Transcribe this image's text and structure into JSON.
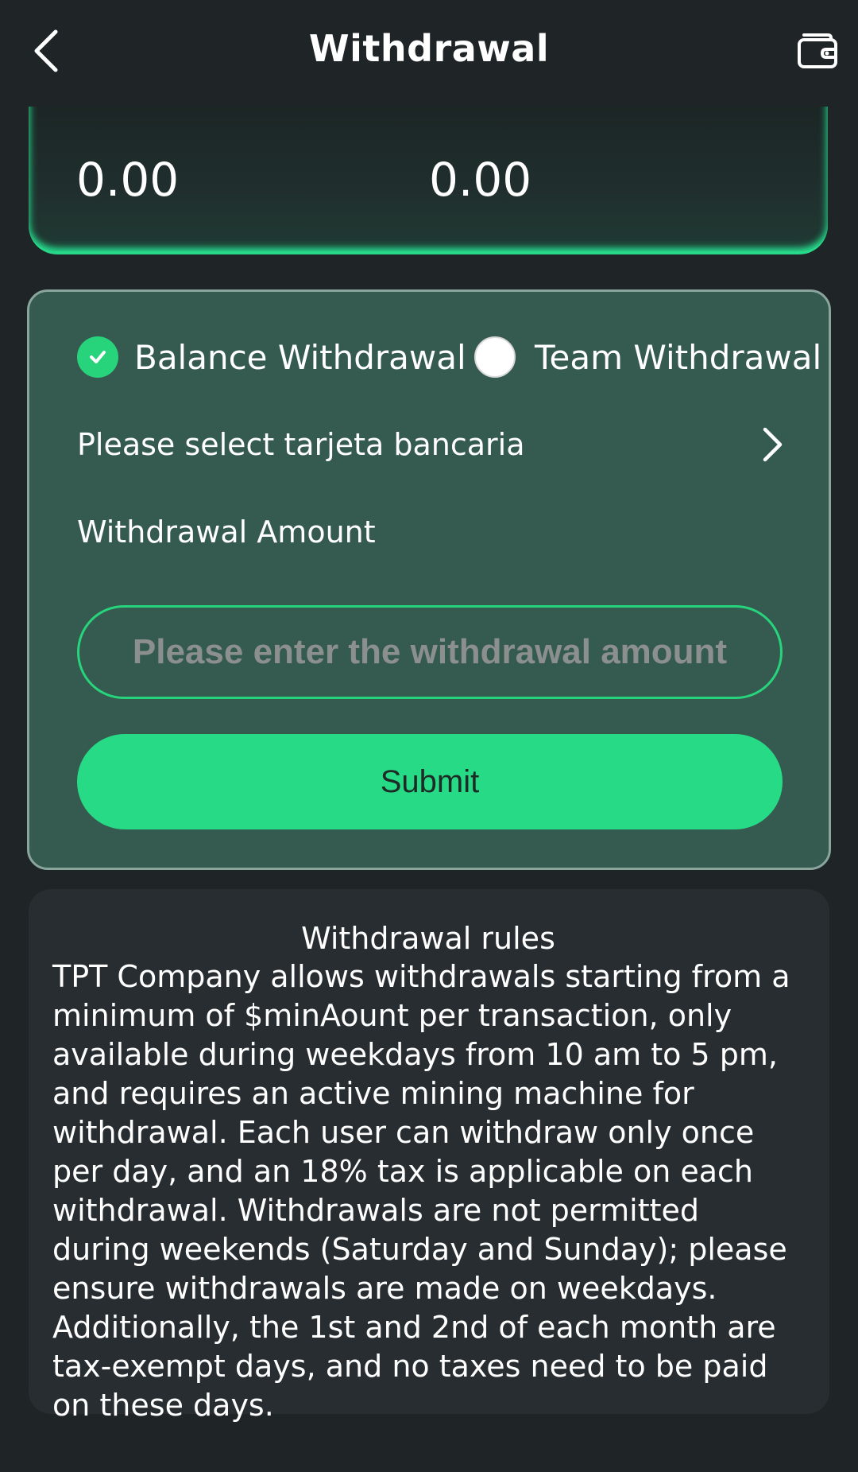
{
  "header": {
    "title": "Withdrawal",
    "back_icon": "chevron-left-icon",
    "wallet_icon": "wallet-icon"
  },
  "balance_card": {
    "left_value": "0.00",
    "right_value": "0.00"
  },
  "form": {
    "options": [
      {
        "label": "Balance Withdrawal",
        "selected": true
      },
      {
        "label": "Team Withdrawal",
        "selected": false
      }
    ],
    "select_card_label": "Please select tarjeta bancaria",
    "amount_label": "Withdrawal Amount",
    "amount_placeholder": "Please enter the withdrawal amount",
    "amount_value": "",
    "submit_label": "Submit"
  },
  "rules": {
    "title": "Withdrawal rules",
    "text": "TPT Company allows withdrawals starting from a minimum of $minAount per transaction, only available during weekdays from 10 am to 5 pm, and requires an active mining machine for withdrawal. Each user can withdraw only once per day, and an 18% tax is applicable on each withdrawal. Withdrawals are not permitted during weekends (Saturday and Sunday); please ensure withdrawals are made on weekdays. Additionally, the 1st and 2nd of each month are tax-exempt days, and no taxes need to be paid on these days."
  },
  "colors": {
    "background": "#1f2426",
    "accent": "#27db86",
    "form_card": "#355b50",
    "rules_card": "#272d30"
  }
}
